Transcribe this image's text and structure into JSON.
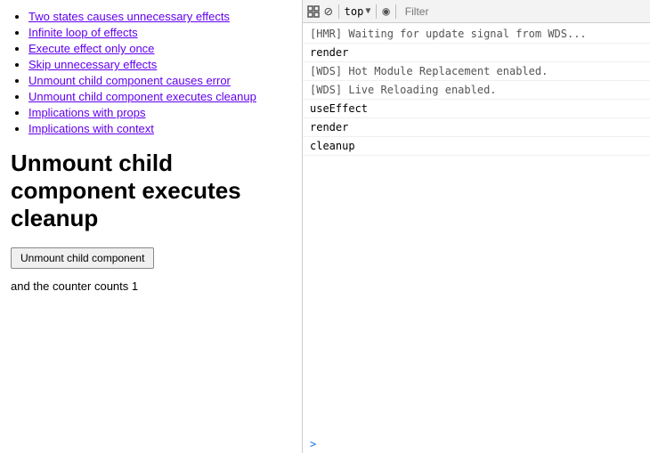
{
  "left_panel": {
    "nav_links": [
      {
        "label": "Two states causes unnecessary effects",
        "id": "two-states"
      },
      {
        "label": "Infinite loop of effects",
        "id": "infinite-loop"
      },
      {
        "label": "Execute effect only once",
        "id": "execute-once"
      },
      {
        "label": "Skip unnecessary effects",
        "id": "skip-unnecessary"
      },
      {
        "label": "Unmount child component causes error",
        "id": "unmount-error"
      },
      {
        "label": "Unmount child component executes cleanup",
        "id": "unmount-cleanup"
      },
      {
        "label": "Implications with props",
        "id": "implications-props"
      },
      {
        "label": "Implications with context",
        "id": "implications-context"
      }
    ],
    "page_title": "Unmount child component executes cleanup",
    "button_label": "Unmount child component",
    "counter_text": "and the counter counts 1"
  },
  "right_panel": {
    "toolbar": {
      "context_label": "top",
      "filter_placeholder": "Filter"
    },
    "console_lines": [
      {
        "text": "[HMR] Waiting for update signal from WDS...",
        "type": "hmr"
      },
      {
        "text": "render",
        "type": "log"
      },
      {
        "text": "[WDS] Hot Module Replacement enabled.",
        "type": "hmr"
      },
      {
        "text": "[WDS] Live Reloading enabled.",
        "type": "hmr"
      },
      {
        "text": "useEffect",
        "type": "log"
      },
      {
        "text": "render",
        "type": "log"
      },
      {
        "text": "cleanup",
        "type": "log"
      }
    ]
  },
  "icons": {
    "inspect": "⊡",
    "no_entry": "⊘",
    "dropdown_arrow": "▼",
    "eye": "◉",
    "prompt_arrow": ">"
  }
}
